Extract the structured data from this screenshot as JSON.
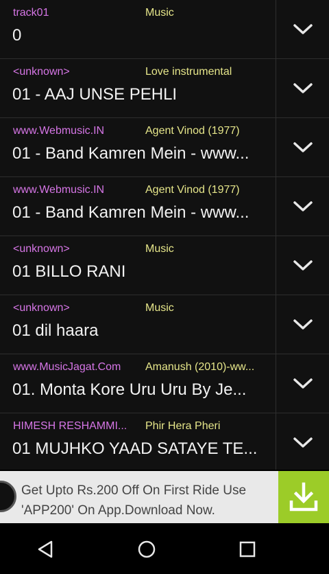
{
  "tracks": [
    {
      "artist": "track01",
      "album": "Music",
      "title": "0"
    },
    {
      "artist": "<unknown>",
      "album": "Love instrumental",
      "title": "01 - AAJ UNSE PEHLI"
    },
    {
      "artist": "www.Webmusic.IN",
      "album": "Agent Vinod (1977)",
      "title": "01 - Band Kamren Mein - www..."
    },
    {
      "artist": "www.Webmusic.IN",
      "album": "Agent Vinod (1977)",
      "title": "01 - Band Kamren Mein - www..."
    },
    {
      "artist": "<unknown>",
      "album": "Music",
      "title": "01 BILLO RANI"
    },
    {
      "artist": "<unknown>",
      "album": "Music",
      "title": "01 dil haara"
    },
    {
      "artist": "www.MusicJagat.Com",
      "album": "Amanush (2010)-ww...",
      "title": "01. Monta Kore Uru Uru By Je..."
    },
    {
      "artist": "HIMESH RESHAMMI...",
      "album": "Phir Hera Pheri",
      "title": "01 MUJHKO YAAD SATAYE TE..."
    }
  ],
  "ad": {
    "text": "Get Upto Rs.200 Off On First Ride Use 'APP200' On App.Download Now."
  },
  "icons": {
    "expand": "chevron-down-icon",
    "download": "download-icon",
    "back": "back-triangle-icon",
    "home": "home-circle-icon",
    "recents": "recents-square-icon"
  },
  "colors": {
    "artist": "#d676e6",
    "album": "#e6e68a",
    "title": "#f2f2f2",
    "background": "#111111",
    "ad_button": "#9ccc28"
  }
}
